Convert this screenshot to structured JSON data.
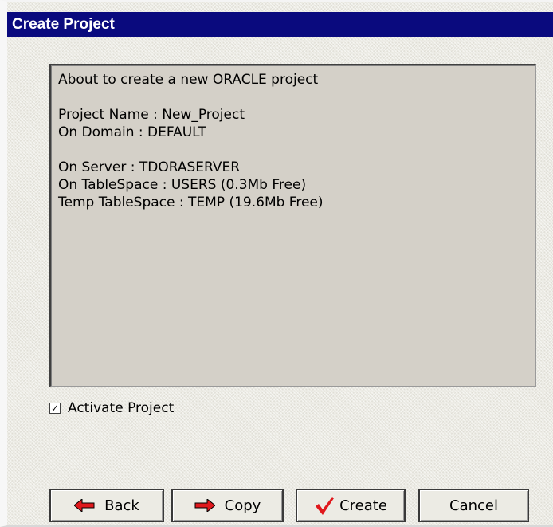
{
  "window": {
    "title": "Create Project"
  },
  "info": {
    "intro": "About to create a new ORACLE project",
    "project_name": "Project Name : New_Project",
    "domain": "On Domain : DEFAULT",
    "server": "On Server : TDORASERVER",
    "tablespace": "On TableSpace : USERS (0.3Mb Free)",
    "temp_tablespace": "Temp TableSpace : TEMP (19.6Mb Free)"
  },
  "activate": {
    "label": "Activate Project",
    "checked": true,
    "check_glyph": "✓"
  },
  "buttons": {
    "back": "Back",
    "copy": "Copy",
    "create": "Create",
    "cancel": "Cancel"
  },
  "colors": {
    "titlebar": "#0a0a7e",
    "arrow_red": "#e0181c",
    "check_red": "#e0181c"
  },
  "icons": {
    "back": "arrow-left-icon",
    "copy": "arrow-right-icon",
    "create": "checkmark-icon"
  }
}
